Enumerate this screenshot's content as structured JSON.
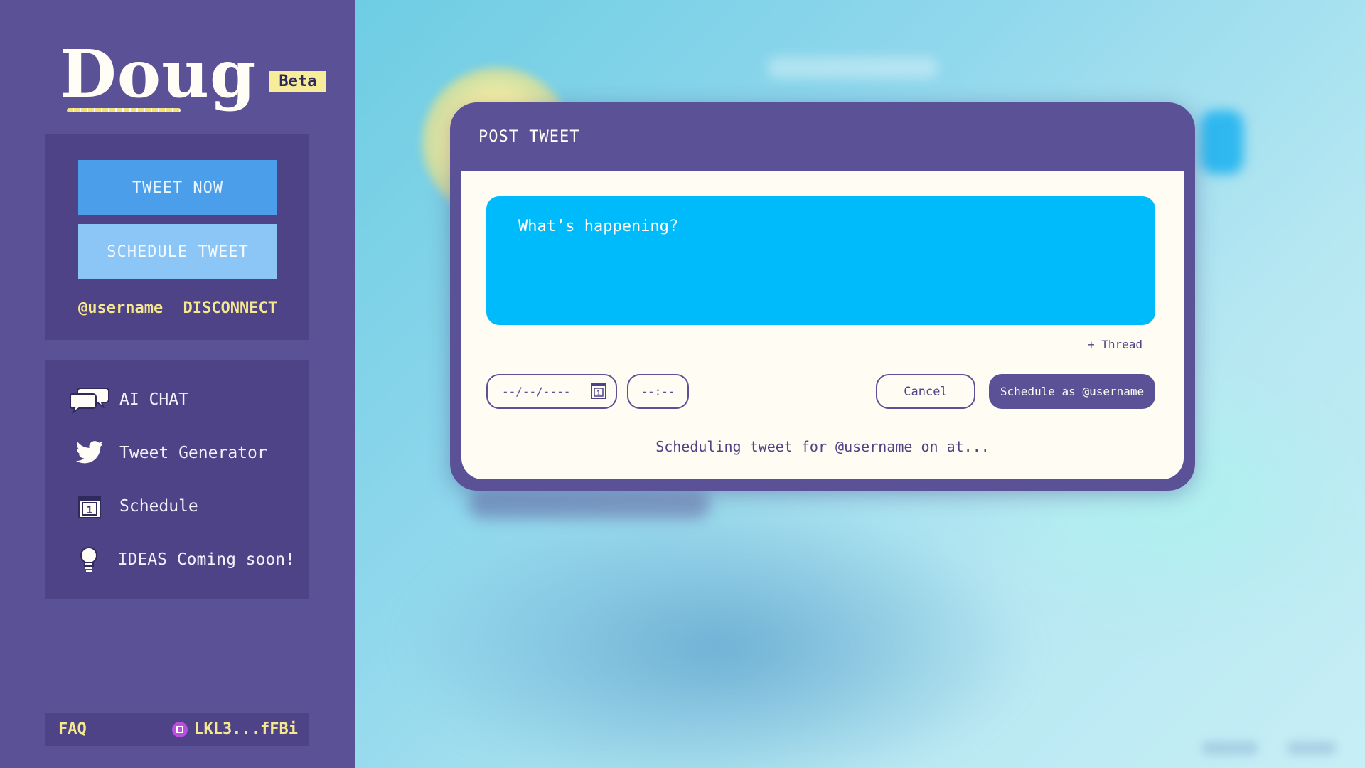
{
  "brand": {
    "name": "Doug",
    "badge": "Beta"
  },
  "sidebar": {
    "tweet_now": "TWEET NOW",
    "schedule_tweet": "SCHEDULE TWEET",
    "username": "@username",
    "disconnect": "DISCONNECT",
    "nav": [
      {
        "label": "AI CHAT",
        "icon": "chat-bubbles-icon"
      },
      {
        "label": "Tweet Generator",
        "icon": "twitter-bird-icon"
      },
      {
        "label": "Schedule",
        "icon": "calendar-icon"
      },
      {
        "label": "IDEAS Coming soon!",
        "icon": "lightbulb-icon"
      }
    ],
    "faq": "FAQ",
    "wallet": "LKL3...fFBi"
  },
  "modal": {
    "title": "POST TWEET",
    "placeholder": "What’s happening?",
    "thread": "+ Thread",
    "date_placeholder": "--/--/----",
    "time_placeholder": "--:--",
    "cancel": "Cancel",
    "schedule_as": "Schedule as @username",
    "status": "Scheduling tweet for @username on at..."
  },
  "colors": {
    "sidebar_bg": "#5b5196",
    "panel_bg": "#4d4386",
    "accent_yellow": "#f6e88e",
    "tweet_blue": "#00bbfb",
    "primary_button": "#4b9fea",
    "secondary_button": "#8cc6f7"
  }
}
